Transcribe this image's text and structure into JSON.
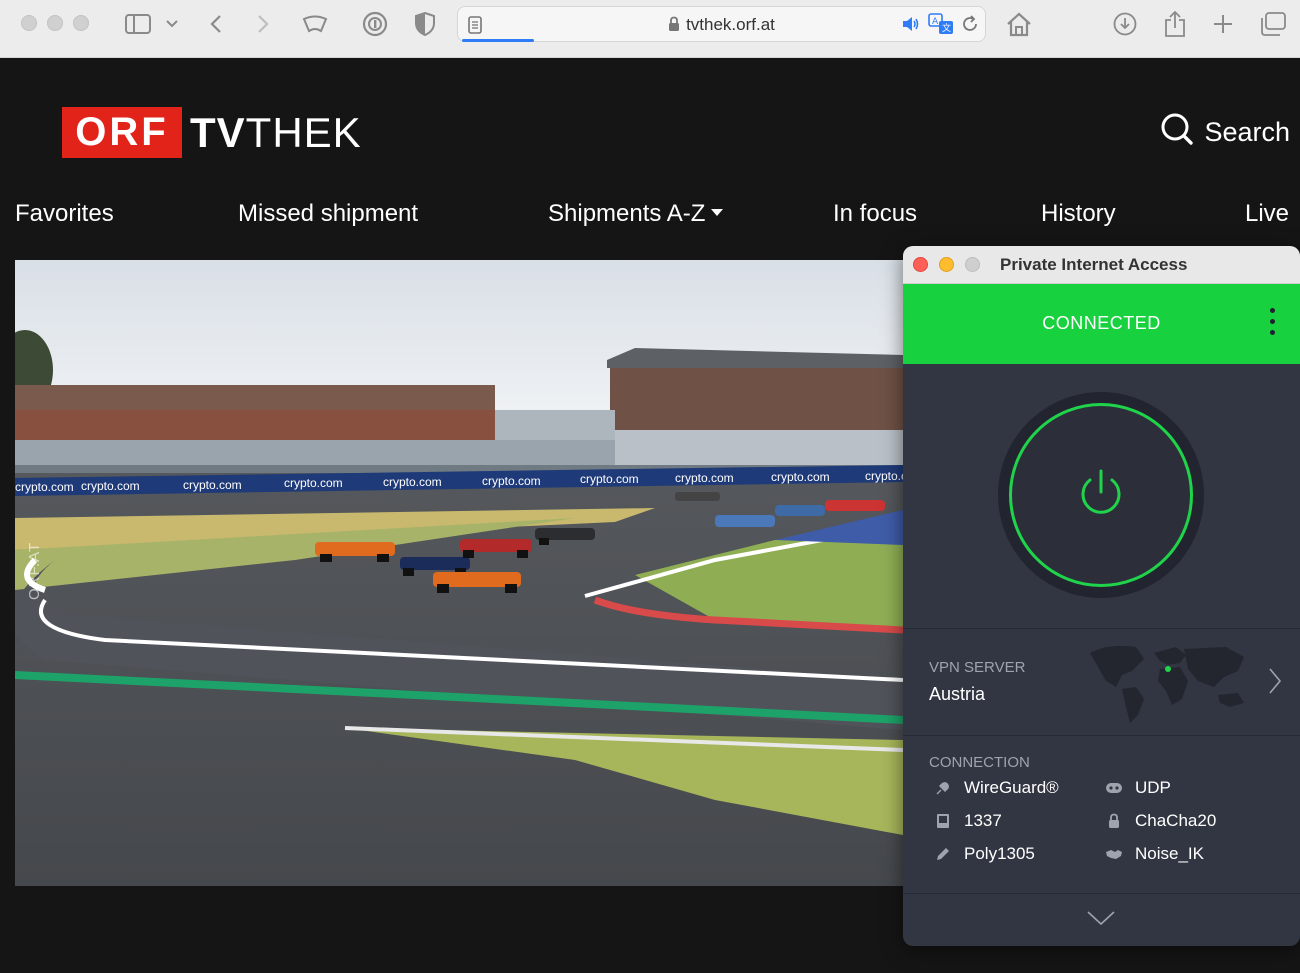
{
  "browser": {
    "url": "tvthek.orf.at"
  },
  "site": {
    "logo_box": "ORF",
    "logo_tv": "TV",
    "logo_thek": "THEK",
    "search_label": "Search",
    "nav": [
      {
        "label": "Favorites"
      },
      {
        "label": "Missed shipment"
      },
      {
        "label": "Shipments A-Z"
      },
      {
        "label": "In focus"
      },
      {
        "label": "History"
      },
      {
        "label": "Live"
      }
    ],
    "video_watermark": "ORF.AT",
    "ad_boards": "crypto.com",
    "brand_color": "#e2231a"
  },
  "pia": {
    "title": "Private Internet Access",
    "status": "CONNECTED",
    "status_color": "#17d13f",
    "server_label": "VPN SERVER",
    "server_name": "Austria",
    "connection_label": "CONNECTION",
    "connection": [
      {
        "icon": "plug-icon",
        "value": "WireGuard®"
      },
      {
        "icon": "gamepad-icon",
        "value": "UDP"
      },
      {
        "icon": "monitor-icon",
        "value": "1337"
      },
      {
        "icon": "lock-icon",
        "value": "ChaCha20"
      },
      {
        "icon": "pen-icon",
        "value": "Poly1305"
      },
      {
        "icon": "handshake-icon",
        "value": "Noise_IK"
      }
    ]
  }
}
